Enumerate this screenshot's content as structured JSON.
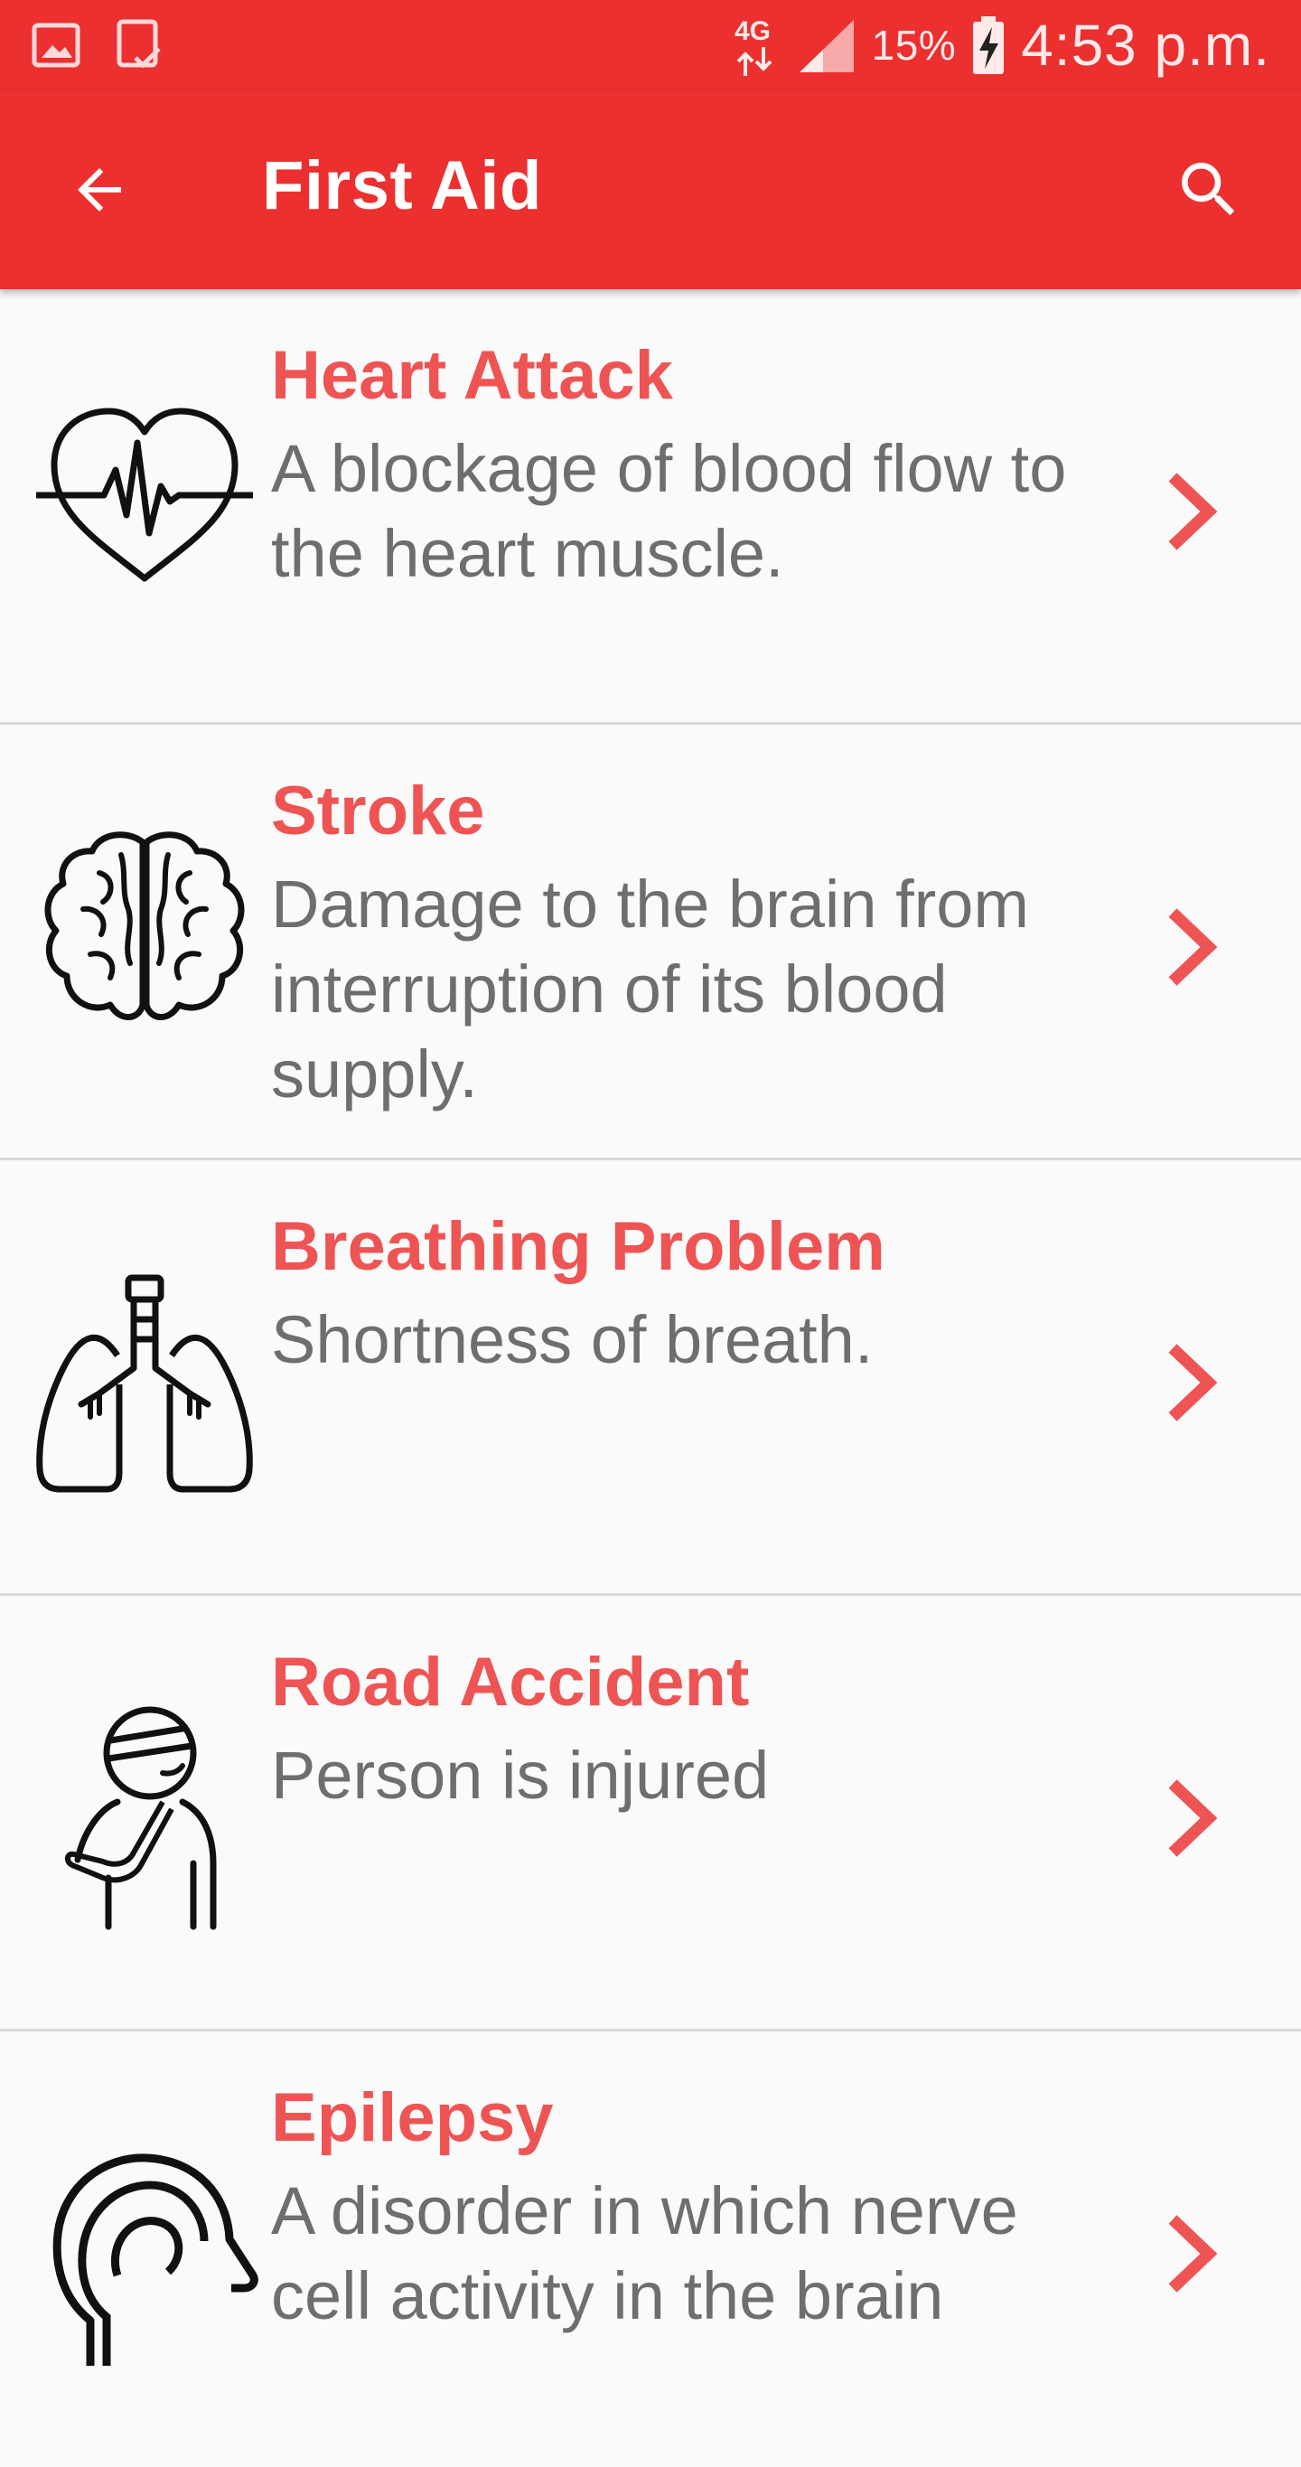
{
  "status_bar": {
    "network": "4G",
    "battery": "15%",
    "time": "4:53 p.m."
  },
  "app_bar": {
    "title": "First Aid",
    "back_icon": "arrow-back-icon",
    "search_icon": "search-icon"
  },
  "colors": {
    "primary": "#ec2f2f",
    "title_red": "#ef5454",
    "description_gray": "#6e6e6e",
    "background": "#fafafa",
    "divider": "#d9d9d9"
  },
  "items": [
    {
      "title": "Heart Attack",
      "description": "A blockage of blood flow to the heart muscle.",
      "icon": "heart-pulse-icon"
    },
    {
      "title": "Stroke",
      "description": "Damage to the brain from interruption of its blood supply.",
      "icon": "brain-icon"
    },
    {
      "title": "Breathing Problem",
      "description": "Shortness of breath.",
      "icon": "lungs-icon"
    },
    {
      "title": "Road Accident",
      "description": "Person is injured",
      "icon": "injured-person-icon"
    },
    {
      "title": "Epilepsy",
      "description": "A disorder in which nerve cell activity in the brain",
      "icon": "head-profile-icon"
    }
  ]
}
